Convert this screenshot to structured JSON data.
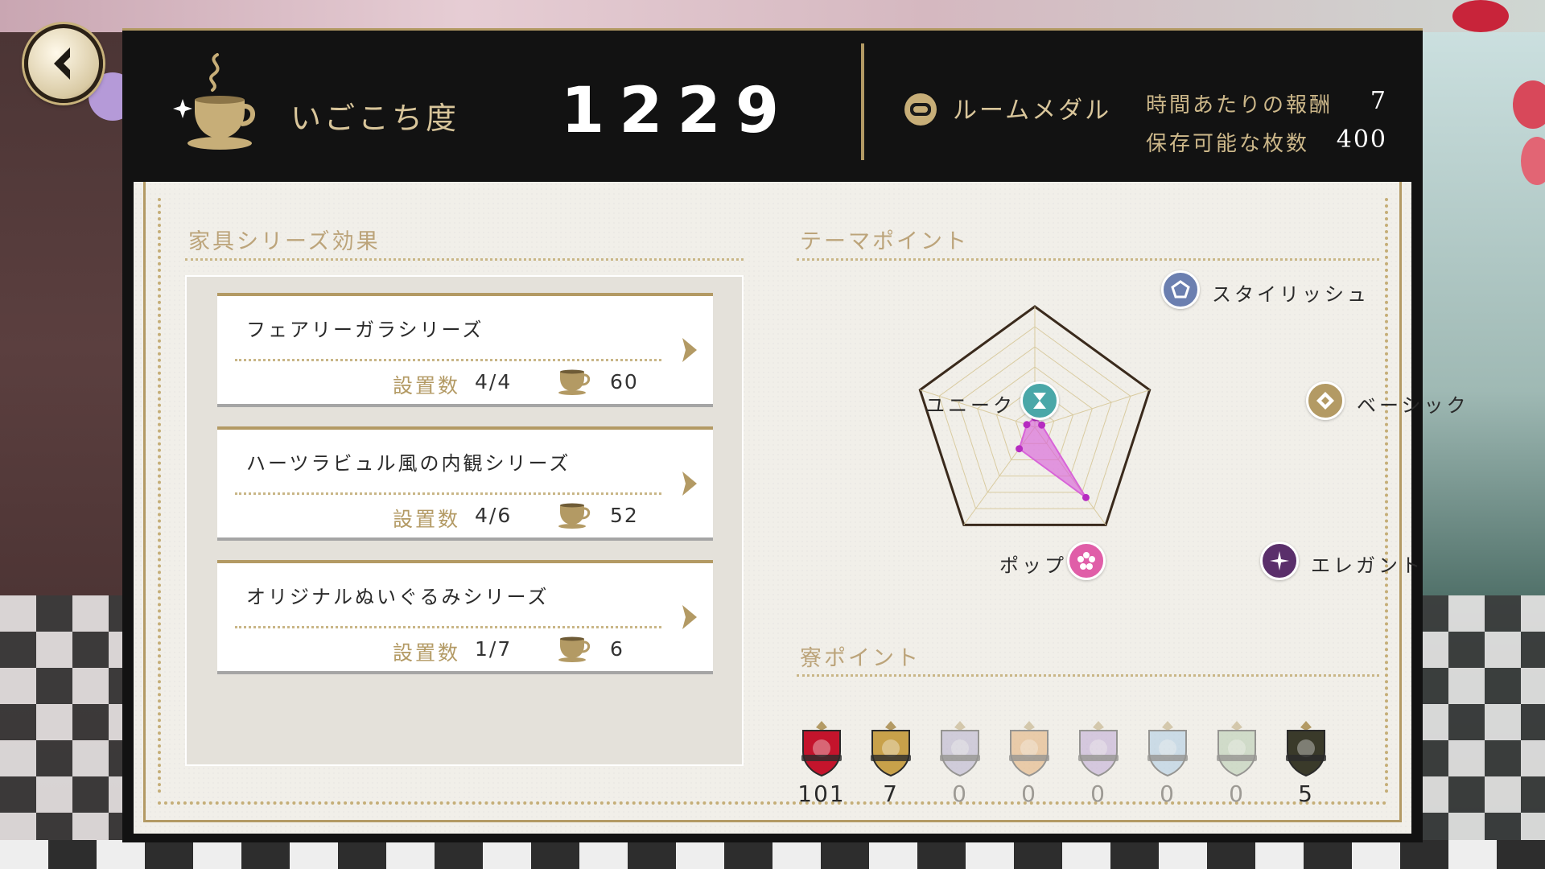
{
  "header": {
    "comfort_label": "いごこち度",
    "comfort_value": "1229",
    "medal_label": "ルームメダル",
    "reward_per_hour_label": "時間あたりの報酬",
    "reward_per_hour_value": "7",
    "storable_label": "保存可能な枚数",
    "storable_value": "400"
  },
  "series_section": {
    "title": "家具シリーズ効果",
    "count_label": "設置数",
    "items": [
      {
        "name": "フェアリーガラシリーズ",
        "count": "4/4",
        "points": "60"
      },
      {
        "name": "ハーツラビュル風の内観シリーズ",
        "count": "4/6",
        "points": "52"
      },
      {
        "name": "オリジナルぬいぐるみシリーズ",
        "count": "1/7",
        "points": "6"
      }
    ]
  },
  "theme_section": {
    "title": "テーマポイント",
    "axes": [
      {
        "label": "スタイリッシュ",
        "icon": "stylish-icon",
        "color": "#6b7fb0",
        "value": 0.08
      },
      {
        "label": "ベーシック",
        "icon": "basic-icon",
        "color": "#b39a64",
        "value": 0.06
      },
      {
        "label": "エレガント",
        "icon": "elegant-icon",
        "color": "#5a2f6b",
        "value": 0.72
      },
      {
        "label": "ポップ",
        "icon": "pop-icon",
        "color": "#e05ea8",
        "value": 0.22
      },
      {
        "label": "ユニーク",
        "icon": "unique-icon",
        "color": "#4aa7a8",
        "value": 0.07
      }
    ],
    "colors": {
      "fill": "#d864d8",
      "grid": "#d9cba0",
      "outline": "#3a2a1c"
    }
  },
  "dorm_section": {
    "title": "寮ポイント",
    "dorms": [
      {
        "name": "heartslabyul-crest",
        "value": "101",
        "active": true,
        "color": "#c4142c"
      },
      {
        "name": "savanaclaw-crest",
        "value": "7",
        "active": true,
        "color": "#c8a14a"
      },
      {
        "name": "octavinelle-crest",
        "value": "0",
        "active": false,
        "color": "#a9a3c8"
      },
      {
        "name": "scarabia-crest",
        "value": "0",
        "active": false,
        "color": "#e1a15c"
      },
      {
        "name": "pomefiore-crest",
        "value": "0",
        "active": false,
        "color": "#b49ad2"
      },
      {
        "name": "ignihyde-crest",
        "value": "0",
        "active": false,
        "color": "#9fc4e3"
      },
      {
        "name": "diasomnia-crest",
        "value": "0",
        "active": false,
        "color": "#a9c4a3"
      },
      {
        "name": "ramshackle-crest",
        "value": "5",
        "active": true,
        "color": "#3a3a2a"
      }
    ]
  }
}
